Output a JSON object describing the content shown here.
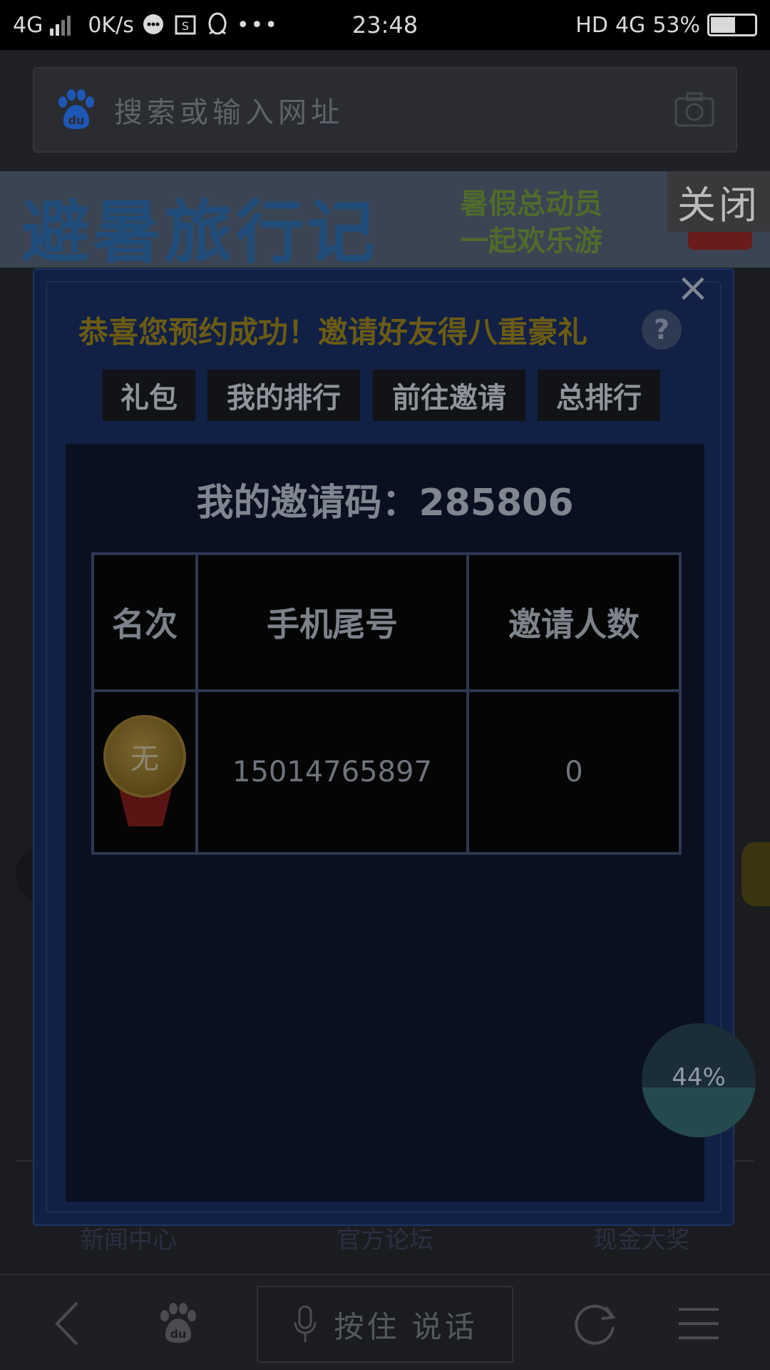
{
  "status_bar": {
    "network": "4G",
    "speed": "0K/s",
    "time": "23:48",
    "hd": "HD",
    "network_right": "4G",
    "battery": "53%",
    "battery_level": 0.53,
    "icons": [
      "signal-icon",
      "chat-icon",
      "screenshot-icon",
      "qq-icon",
      "more-icon",
      "battery-icon"
    ]
  },
  "address_bar": {
    "placeholder": "搜索或输入网址",
    "logo_text": "du",
    "icons": [
      "baidu-logo-icon",
      "camera-icon"
    ]
  },
  "banner": {
    "title": "避暑旅行记",
    "subtitle_line1": "暑假总动员",
    "subtitle_line2": "一起欢乐游",
    "close_label": "关闭"
  },
  "modal": {
    "title": "恭喜您预约成功！邀请好友得八重豪礼",
    "help_label": "?",
    "close_label": "×",
    "tabs": [
      "礼包",
      "我的排行",
      "前往邀请",
      "总排行"
    ],
    "invite_code_label": "我的邀请码：285806",
    "table": {
      "headers": [
        "名次",
        "手机尾号",
        "邀请人数"
      ],
      "rows": [
        {
          "rank": "无",
          "phone": "15014765897",
          "invites": "0"
        }
      ]
    }
  },
  "background": {
    "links": [
      "新闻中心",
      "官方论坛",
      "现金大奖"
    ]
  },
  "progress": {
    "label": "44%",
    "value": 0.44
  },
  "toolbar": {
    "voice_label": "按住 说话",
    "baidu_text": "du",
    "icons": [
      "back-icon",
      "baidu-home-icon",
      "microphone-icon",
      "refresh-icon",
      "menu-icon"
    ]
  },
  "colors": {
    "modal_bg": "#112044",
    "title_gold": "#6b5b14",
    "status_bar_bg": "#000000"
  }
}
